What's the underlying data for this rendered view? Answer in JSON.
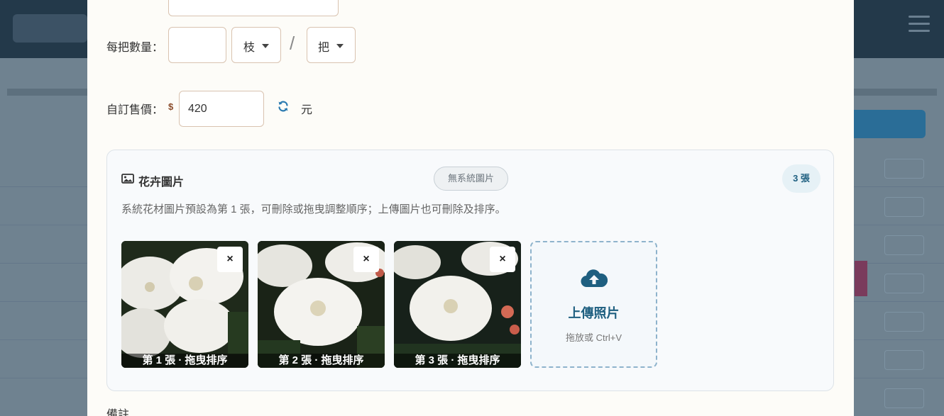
{
  "modal": {
    "qty_label": "每把數量：",
    "qty_value": "",
    "unit_select": "枝",
    "slash": "/",
    "bundle_select": "把",
    "price_label": "自訂售價：",
    "currency_symbol": "$",
    "price_value": "420",
    "price_unit": "元",
    "notes_label": "備註"
  },
  "photos": {
    "title": "花卉圖片",
    "system_badge": "無系統圖片",
    "count_badge": "3 張",
    "description": "系統花材圖片預設為第 1 張，可刪除或拖曳調整順序；上傳圖片也可刪除及排序。",
    "items": [
      {
        "caption": "第 1 張 · 拖曳排序",
        "close": "×"
      },
      {
        "caption": "第 2 張 · 拖曳排序",
        "close": "×"
      },
      {
        "caption": "第 3 張 · 拖曳排序",
        "close": "×"
      }
    ],
    "upload_title": "上傳照片",
    "upload_hint": "拖放或 Ctrl+V"
  },
  "colors": {
    "accent": "#1e5f80",
    "border": "#d9c3b0",
    "modal_bg": "#fdfcf8"
  }
}
